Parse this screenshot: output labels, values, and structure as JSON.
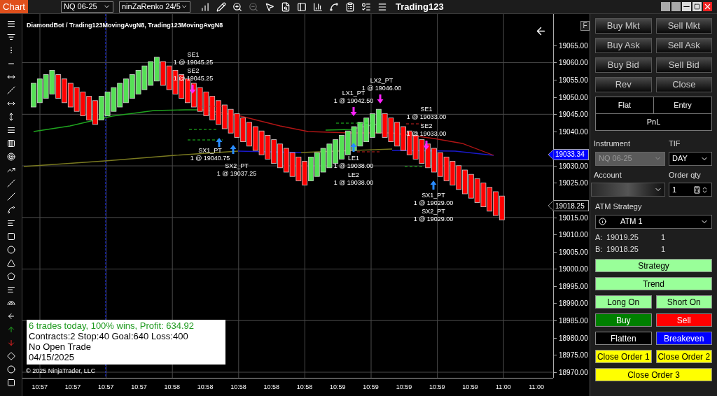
{
  "app_tab": "Chart",
  "instrument_select": "NQ 06-25",
  "bar_type_select": "ninZaRenko 24/5",
  "window_title": "Trading123",
  "chart": {
    "title": "DiamondBot / Trading123MovingAvgN8, Trading123MovingAvgN8",
    "bricks": [
      {
        "kind": "up"
      },
      {
        "kind": "up"
      },
      {
        "kind": "up"
      },
      {
        "kind": "up"
      },
      {
        "kind": "down"
      },
      {
        "kind": "down"
      },
      {
        "kind": "down"
      },
      {
        "kind": "down"
      },
      {
        "kind": "down"
      },
      {
        "kind": "down"
      },
      {
        "kind": "down"
      },
      {
        "kind": "up"
      },
      {
        "kind": "up"
      },
      {
        "kind": "up"
      },
      {
        "kind": "up"
      },
      {
        "kind": "up"
      },
      {
        "kind": "up"
      },
      {
        "kind": "up"
      },
      {
        "kind": "up"
      },
      {
        "kind": "up"
      },
      {
        "kind": "up"
      },
      {
        "kind": "down"
      },
      {
        "kind": "down"
      },
      {
        "kind": "down"
      },
      {
        "kind": "down"
      },
      {
        "kind": "down"
      },
      {
        "kind": "down"
      },
      {
        "kind": "down"
      },
      {
        "kind": "down"
      },
      {
        "kind": "down"
      },
      {
        "kind": "down"
      },
      {
        "kind": "down"
      },
      {
        "kind": "down"
      },
      {
        "kind": "down"
      },
      {
        "kind": "down"
      },
      {
        "kind": "down"
      },
      {
        "kind": "down"
      },
      {
        "kind": "down"
      },
      {
        "kind": "down"
      },
      {
        "kind": "down"
      },
      {
        "kind": "down"
      },
      {
        "kind": "down"
      },
      {
        "kind": "down"
      },
      {
        "kind": "down"
      },
      {
        "kind": "down"
      },
      {
        "kind": "up"
      },
      {
        "kind": "up"
      },
      {
        "kind": "up"
      },
      {
        "kind": "up"
      },
      {
        "kind": "up"
      },
      {
        "kind": "up"
      },
      {
        "kind": "up"
      },
      {
        "kind": "up"
      },
      {
        "kind": "up"
      },
      {
        "kind": "up"
      },
      {
        "kind": "up"
      },
      {
        "kind": "up"
      },
      {
        "kind": "down"
      },
      {
        "kind": "down"
      },
      {
        "kind": "down"
      },
      {
        "kind": "down"
      },
      {
        "kind": "down"
      },
      {
        "kind": "down"
      },
      {
        "kind": "down"
      },
      {
        "kind": "down"
      },
      {
        "kind": "down"
      },
      {
        "kind": "down"
      },
      {
        "kind": "down"
      },
      {
        "kind": "down"
      },
      {
        "kind": "down"
      },
      {
        "kind": "down"
      },
      {
        "kind": "down"
      },
      {
        "kind": "down"
      },
      {
        "kind": "down"
      },
      {
        "kind": "down"
      },
      {
        "kind": "down"
      },
      {
        "kind": "down"
      }
    ],
    "trades": [
      {
        "label": "SE1",
        "fill": "1 @ 19045.25"
      },
      {
        "label": "SE2",
        "fill": "1 @ 19045.25"
      },
      {
        "label": "SX1_PT",
        "fill": "1 @ 19040.75"
      },
      {
        "label": "SX2_PT",
        "fill": "1 @ 19037.25"
      },
      {
        "label": "LX2_PT",
        "fill": "1 @ 19046.00"
      },
      {
        "label": "LX1_PT",
        "fill": "1 @ 19042.50"
      },
      {
        "label": "LE1",
        "fill": "1 @ 19038.00"
      },
      {
        "label": "LE2",
        "fill": "1 @ 19038.00"
      },
      {
        "label": "SE1",
        "fill": "1 @ 19033.00"
      },
      {
        "label": "SE2",
        "fill": "1 @ 19033.00"
      },
      {
        "label": "SX1_PT",
        "fill": "1 @ 19029.00"
      },
      {
        "label": "SX2_PT",
        "fill": "1 @ 19029.00"
      }
    ],
    "info_lines": [
      {
        "text": "6 trades today, 100% wins, Profit: 634.92",
        "color": "#1f9a1f"
      },
      {
        "text": "Contracts:2 Stop:40 Goal:640 Loss:400",
        "color": "#000000"
      },
      {
        "text": "No Open Trade",
        "color": "#000000"
      },
      {
        "text": "04/15/2025",
        "color": "#000000"
      }
    ],
    "copyright": "© 2025 NinjaTrader, LLC",
    "format_button": "F",
    "y_axis": [
      {
        "kind": "tick",
        "text": "19065.00"
      },
      {
        "kind": "tick",
        "text": "19060.00"
      },
      {
        "kind": "tick",
        "text": "19055.00"
      },
      {
        "kind": "tick",
        "text": "19050.00"
      },
      {
        "kind": "tick",
        "text": "19045.00"
      },
      {
        "kind": "tick",
        "text": "19040.00"
      },
      {
        "kind": "marker",
        "text": "19033.34",
        "color": "#0000ff"
      },
      {
        "kind": "tick",
        "text": "19030.00"
      },
      {
        "kind": "tick",
        "text": "19025.00"
      },
      {
        "kind": "marker",
        "text": "19018.25",
        "color": "#000000"
      },
      {
        "kind": "tick",
        "text": "19015.00"
      },
      {
        "kind": "tick",
        "text": "19010.00"
      },
      {
        "kind": "tick",
        "text": "19005.00"
      },
      {
        "kind": "tick",
        "text": "19000.00"
      },
      {
        "kind": "tick",
        "text": "18995.00"
      },
      {
        "kind": "tick",
        "text": "18990.00"
      },
      {
        "kind": "tick",
        "text": "18985.00"
      },
      {
        "kind": "tick",
        "text": "18980.00"
      },
      {
        "kind": "tick",
        "text": "18975.00"
      },
      {
        "kind": "tick",
        "text": "18970.00"
      }
    ],
    "x_axis": [
      "10:57",
      "10:57",
      "10:57",
      "10:57",
      "10:58",
      "10:58",
      "10:58",
      "10:58",
      "10:58",
      "10:59",
      "10:59",
      "10:59",
      "10:59",
      "10:59",
      "11:00",
      "11:00"
    ]
  },
  "order_panel": {
    "order_buttons": [
      "Buy Mkt",
      "Sell Mkt",
      "Buy Ask",
      "Sell Ask",
      "Buy Bid",
      "Sell Bid",
      "Rev",
      "Close"
    ],
    "position_cells": [
      "Flat",
      "Entry"
    ],
    "pnl": "PnL",
    "instrument": {
      "label": "Instrument",
      "value": "NQ 06-25",
      "disabled": true
    },
    "tif": {
      "label": "TIF",
      "value": "DAY"
    },
    "account": {
      "label": "Account"
    },
    "order_qty": {
      "label": "Order qty",
      "value": "1"
    },
    "atm_strategy": {
      "label": "ATM Strategy",
      "value": "ATM 1"
    },
    "quotes": [
      {
        "label": "A:",
        "price": "19019.25",
        "qty": "1"
      },
      {
        "label": "B:",
        "price": "19018.25",
        "qty": "1"
      }
    ],
    "strategy_rows": [
      [
        {
          "label": "Strategy",
          "color": "#99ff99"
        }
      ],
      [
        {
          "label": "Trend",
          "color": "#99ff99"
        }
      ],
      [
        {
          "label": "Long On",
          "color": "#99ff99"
        },
        {
          "label": "Short On",
          "color": "#99ff99"
        }
      ],
      [
        {
          "label": "Buy",
          "color": "#008000"
        },
        {
          "label": "Sell",
          "color": "#ff0000"
        }
      ],
      [
        {
          "label": "Flatten",
          "color": "#000000"
        },
        {
          "label": "Breakeven",
          "color": "#0000ff"
        }
      ],
      [
        {
          "label": "Close Order 1",
          "color": "#ffff00"
        },
        {
          "label": "Close Order 2",
          "color": "#ffff00"
        }
      ],
      [
        {
          "label": "Close Order 3",
          "color": "#ffff00"
        }
      ]
    ]
  }
}
